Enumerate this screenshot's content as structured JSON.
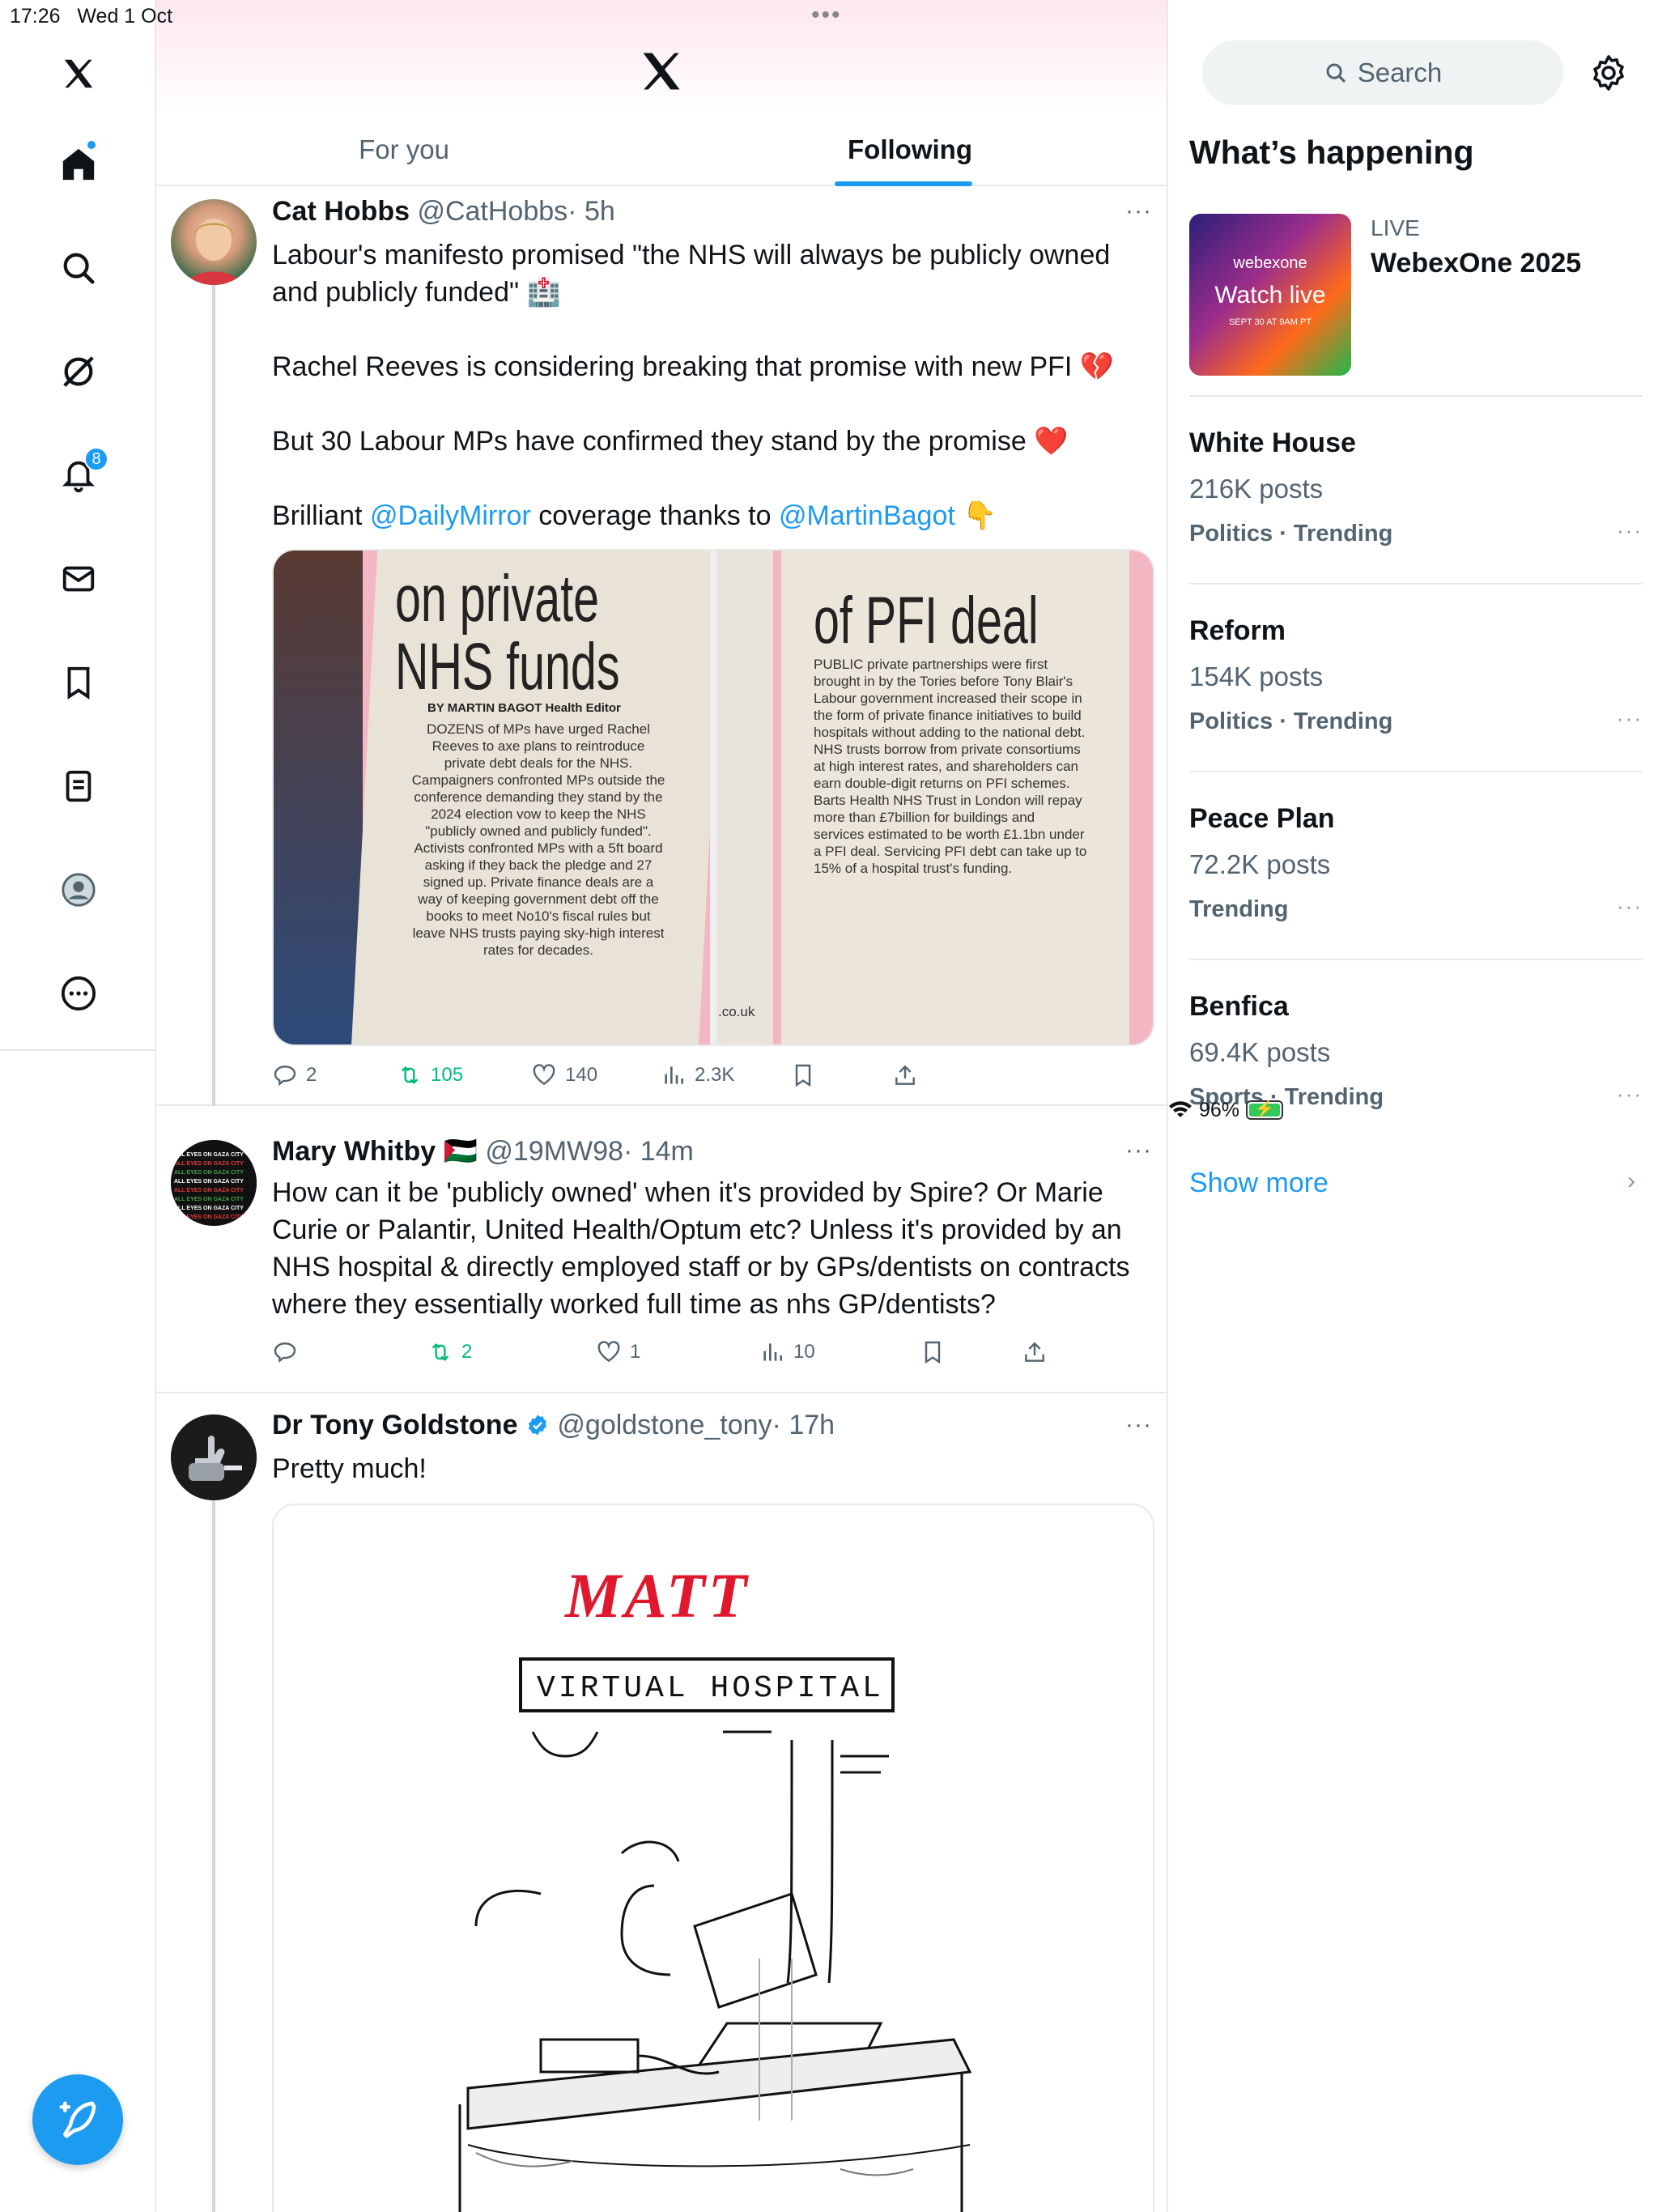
{
  "status": {
    "time": "17:26",
    "date": "Wed 1 Oct",
    "battery": "96%"
  },
  "nav": {
    "notifications_count": "8"
  },
  "tabs": [
    {
      "label": "For you"
    },
    {
      "label": "Following"
    }
  ],
  "tweets": [
    {
      "name": "Cat Hobbs",
      "handle": "@CatHobbs",
      "time": "· 5h",
      "text": [
        "Labour's manifesto promised \"the NHS will always be publicly owned and publicly funded\" 🏥",
        "Rachel Reeves is considering breaking that promise with new PFI 💔",
        "But 30 Labour MPs have confirmed they stand by the promise ❤️"
      ],
      "brilliant_prefix": "Brilliant",
      "mention1": "@DailyMirror",
      "coverage": "coverage thanks to",
      "mention2": "@MartinBagot",
      "emoji_end": "👇",
      "clip1": {
        "headline1": "on private",
        "headline2": "NHS funds",
        "byline": "BY MARTIN BAGOT Health Editor",
        "body": "DOZENS of MPs have urged Rachel Reeves to axe plans to reintroduce private debt deals for the NHS. Campaigners confronted MPs outside the conference demanding they stand by the 2024 election vow to keep the NHS \"publicly owned and publicly funded\". Activists confronted MPs with a 5ft board asking if they back the pledge and 27 signed up. Private finance deals are a way of keeping government debt off the books to meet No10's fiscal rules but leave NHS trusts paying sky-high interest rates for decades."
      },
      "clip2": {
        "headline": "of PFI deal",
        "body": "PUBLIC private partnerships were first brought in by the Tories before Tony Blair's Labour government increased their scope in the form of private finance initiatives to build hospitals without adding to the national debt. NHS trusts borrow from private consortiums at high interest rates, and shareholders can earn double-digit returns on PFI schemes. Barts Health NHS Trust in London will repay more than £7billion for buildings and services estimated to be worth £1.1bn under a PFI deal. Servicing PFI debt can take up to 15% of a hospital trust's funding.",
        "side": ".co.uk"
      },
      "replies": "2",
      "reposts": "105",
      "likes": "140",
      "views": "2.3K"
    },
    {
      "name": "Mary Whitby",
      "flag": "🇵🇸",
      "handle": "@19MW98",
      "time": "· 14m",
      "text": "How can it be 'publicly owned' when it's provided by Spire? Or Marie Curie or Palantir, United Health/Optum etc? Unless it's provided by an NHS hospital & directly employed staff or by GPs/dentists on contracts where they essentially worked full time as nhs GP/dentists?",
      "avatar_text": "ALL EYES ON GAZA CITY",
      "replies": "",
      "reposts": "2",
      "likes": "1",
      "views": "10"
    },
    {
      "name": "Dr Tony Goldstone",
      "handle": "@goldstone_tony",
      "time": "· 17h",
      "text": "Pretty much!",
      "cartoon_signature": "MATT",
      "cartoon_sign": "VIRTUAL HOSPITAL"
    }
  ],
  "sidebar": {
    "search_placeholder": "Search",
    "title": "What’s happening",
    "live": {
      "label": "LIVE",
      "title": "WebexOne 2025",
      "brand": "webexone",
      "watch": "Watch live",
      "date": "SEPT 30 AT 9AM PT"
    },
    "trends": [
      {
        "title": "White House",
        "count": "216K posts",
        "category": "Politics · Trending"
      },
      {
        "title": "Reform",
        "count": "154K posts",
        "category": "Politics · Trending"
      },
      {
        "title": "Peace Plan",
        "count": "72.2K posts",
        "category": "Trending"
      },
      {
        "title": "Benfica",
        "count": "69.4K posts",
        "category": "Sports · Trending"
      }
    ],
    "show_more": "Show more"
  },
  "colors": {
    "accent": "#1d9bf0",
    "repost": "#00ba7c",
    "muted": "#536471"
  }
}
